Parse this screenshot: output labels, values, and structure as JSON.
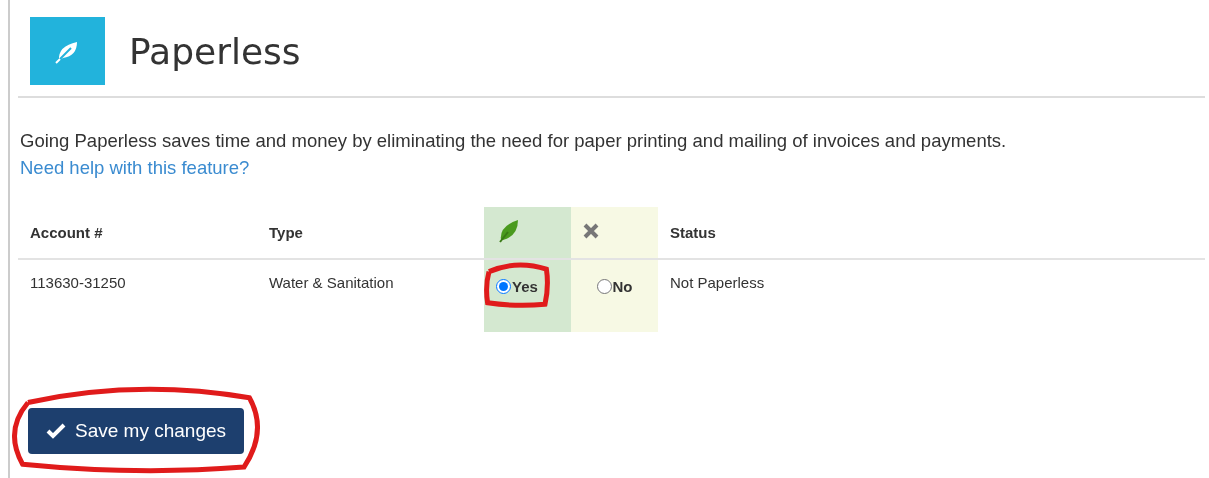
{
  "header": {
    "title": "Paperless"
  },
  "intro": {
    "text": "Going Paperless saves time and money by eliminating the need for paper printing and mailing of invoices and payments.",
    "link": "Need help with this feature?"
  },
  "table": {
    "columns": [
      {
        "label": "Account #",
        "kind": "text"
      },
      {
        "label": "Type",
        "kind": "text"
      },
      {
        "kind": "yes"
      },
      {
        "kind": "no"
      },
      {
        "label": "Status",
        "kind": "text"
      }
    ],
    "rows": [
      {
        "account": "113630-31250",
        "type": "Water & Sanitation",
        "options": [
          {
            "label": "Yes",
            "selected": true,
            "circled": true
          },
          {
            "label": "No",
            "selected": false,
            "circled": false
          }
        ],
        "status": "Not Paperless"
      }
    ]
  },
  "save_button": {
    "label": "Save my changes",
    "circled": true
  }
}
